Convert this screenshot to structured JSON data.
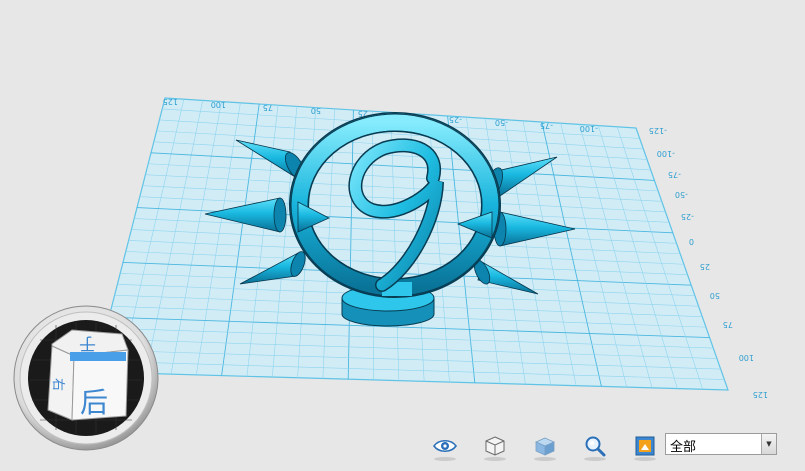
{
  "viewport": {
    "x_axis_ticks": [
      "125",
      "100",
      "75",
      "50",
      "25",
      "0",
      "-25",
      "-50",
      "-75",
      "-100",
      "-125"
    ],
    "y_axis_ticks": [
      "-125",
      "-100",
      "-75",
      "-50",
      "-25",
      "0",
      "25",
      "50",
      "75",
      "100",
      "125"
    ]
  },
  "view_cube": {
    "top_face_glyph": "于",
    "front_face_label": "后",
    "side_face_label": "右"
  },
  "toolbar": {
    "buttons": [
      {
        "icon": "eye-icon"
      },
      {
        "icon": "wireframe-cube-icon"
      },
      {
        "icon": "solid-cube-icon"
      },
      {
        "icon": "zoom-icon"
      },
      {
        "icon": "fit-view-icon"
      }
    ]
  },
  "view_select": {
    "value": "全部"
  },
  "colors": {
    "model": "#19b6dc",
    "grid_line": "#7fd0ec",
    "grid_fill": "#cdeaf5",
    "background": "#e7e7e7"
  }
}
